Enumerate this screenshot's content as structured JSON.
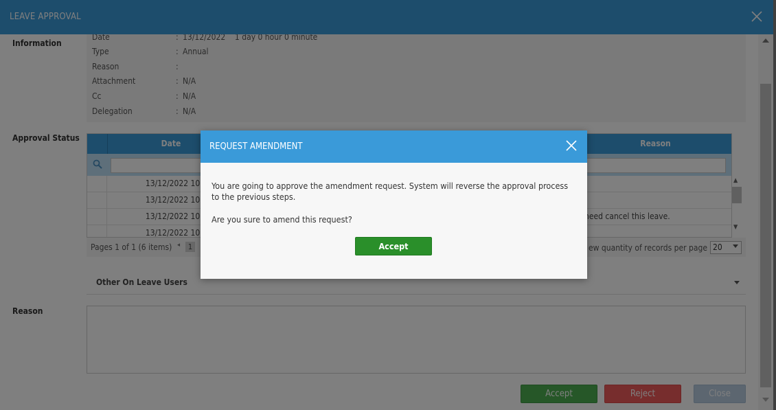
{
  "window": {
    "title": "LEAVE APPROVAL"
  },
  "information": {
    "label": "Information",
    "rows": [
      {
        "key": "Date",
        "sep": ":",
        "value": "13/12/2022    1 day 0 hour 0 minute"
      },
      {
        "key": "Type",
        "sep": ":",
        "value": "Annual"
      },
      {
        "key": "Reason",
        "sep": ":",
        "value": ""
      },
      {
        "key": "Attachment",
        "sep": ":",
        "value": "N/A"
      },
      {
        "key": "Cc",
        "sep": ":",
        "value": "N/A"
      },
      {
        "key": "Delegation",
        "sep": ":",
        "value": "N/A"
      }
    ]
  },
  "approval_status": {
    "label": "Approval Status",
    "columns": [
      "Date",
      "Reason"
    ],
    "rows": [
      {
        "date": "13/12/2022 10:08:27",
        "reason": ""
      },
      {
        "date": "13/12/2022 10:10:19",
        "reason": ""
      },
      {
        "date": "13/12/2022 10:11:34",
        "reason": "need cancel this leave."
      },
      {
        "date": "13/12/2022 10:12:03",
        "reason": ""
      }
    ],
    "pager_text": "Pages 1 of 1 (6 items)",
    "page_arrow": "◂",
    "current_page": "1",
    "per_page_label": "ew quantity of records per page",
    "per_page_value": "20"
  },
  "other_users": {
    "label": "Other On Leave Users"
  },
  "reason": {
    "label": "Reason"
  },
  "buttons": {
    "accept": "Accept",
    "reject": "Reject",
    "close": "Close"
  },
  "modal": {
    "title": "REQUEST AMENDMENT",
    "message1": "You are going to approve the amendment request. System will reverse the approval process to the previous steps.",
    "message2": "Are you sure to amend this request?",
    "accept": "Accept"
  },
  "colors": {
    "header_blue": "#3a9ad9",
    "accept_green": "#2a8f2a",
    "reject_red": "#ef5a5a"
  }
}
